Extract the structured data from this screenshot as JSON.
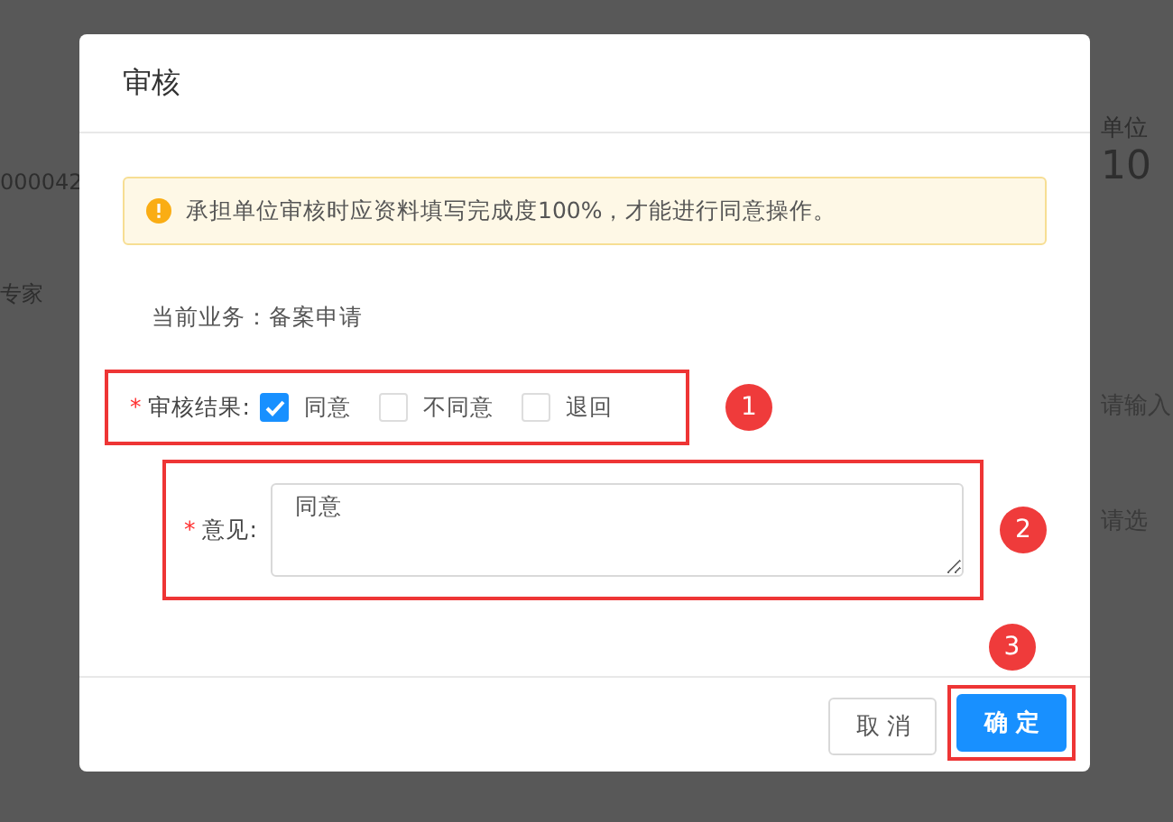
{
  "background": {
    "left_texts": [
      "000042",
      "专家"
    ],
    "right_label": "单位",
    "right_value": "10",
    "right_fields": [
      {
        "placeholder": "请输入"
      },
      {
        "placeholder": "请选"
      }
    ]
  },
  "dialog": {
    "title": "审核",
    "alert": {
      "text": "承担单位审核时应资料填写完成度100%，才能进行同意操作。"
    },
    "business": {
      "label": "当前业务：",
      "value": "备案申请"
    },
    "result": {
      "label": "审核结果:",
      "required_mark": "*",
      "options": [
        {
          "label": "同意",
          "checked": true
        },
        {
          "label": "不同意",
          "checked": false
        },
        {
          "label": "退回",
          "checked": false
        }
      ]
    },
    "opinion": {
      "label": "意见:",
      "required_mark": "*",
      "value": "同意"
    },
    "buttons": [
      {
        "label": "取 消",
        "kind": "default"
      },
      {
        "label": "确 定",
        "kind": "primary"
      }
    ]
  },
  "annotations": [
    {
      "number": "1"
    },
    {
      "number": "2"
    },
    {
      "number": "3"
    }
  ]
}
